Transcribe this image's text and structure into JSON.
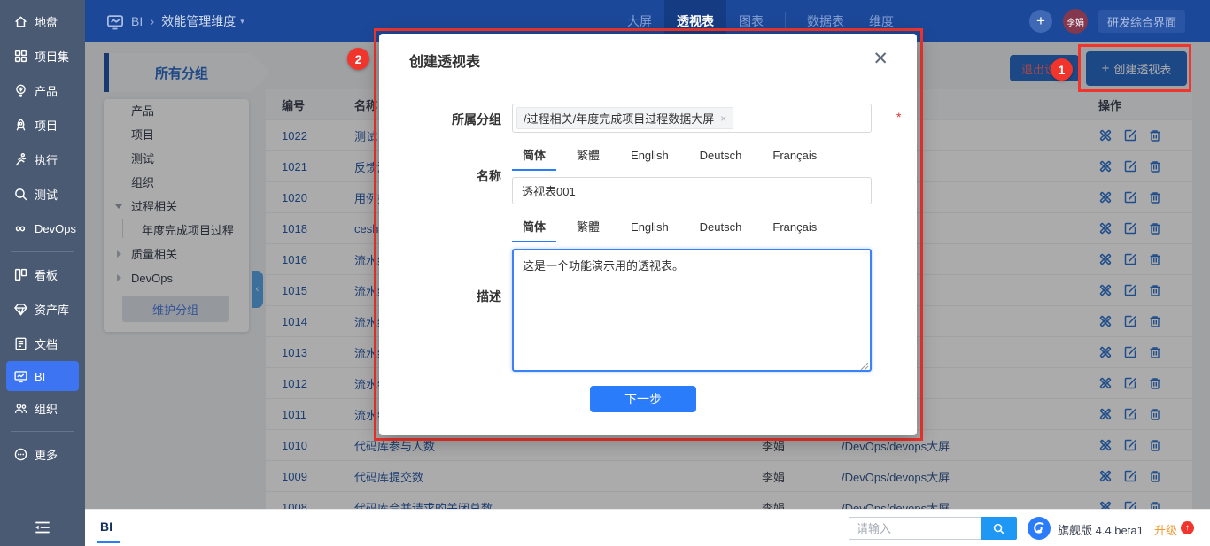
{
  "topbar": {
    "app": "BI",
    "breadcrumb_sep": "›",
    "section": "效能管理维度",
    "section_caret": "▾",
    "tabs": [
      {
        "key": "screen",
        "label": "大屏"
      },
      {
        "key": "pivot",
        "label": "透视表",
        "active": true
      },
      {
        "key": "chart",
        "label": "图表"
      },
      {
        "key": "dataset",
        "label": "数据表",
        "divider_before": true
      },
      {
        "key": "dimension",
        "label": "维度"
      }
    ],
    "add_plus": "+",
    "avatar": "李娟",
    "workspace_button": "研发综合界面"
  },
  "sidebar": {
    "items": [
      {
        "label": "地盘",
        "icon": "home-icon"
      },
      {
        "label": "项目集",
        "icon": "program-icon"
      },
      {
        "label": "产品",
        "icon": "product-icon"
      },
      {
        "label": "项目",
        "icon": "project-icon"
      },
      {
        "label": "执行",
        "icon": "execution-icon"
      },
      {
        "label": "测试",
        "icon": "test-icon"
      },
      {
        "label": "DevOps",
        "icon": "devops-icon"
      },
      {
        "divider": true
      },
      {
        "label": "看板",
        "icon": "kanban-icon"
      },
      {
        "label": "资产库",
        "icon": "asset-icon"
      },
      {
        "label": "文档",
        "icon": "doc-icon"
      },
      {
        "label": "BI",
        "icon": "bi-icon",
        "active": true
      },
      {
        "label": "组织",
        "icon": "org-icon"
      },
      {
        "divider": true
      },
      {
        "label": "更多",
        "icon": "more-icon"
      }
    ]
  },
  "toolbar": {
    "group_tab": "所有分组",
    "exit_button": "退出设置",
    "create_plus": "+",
    "create_button": "创建透视表"
  },
  "tree": {
    "items": [
      {
        "label": "产品"
      },
      {
        "label": "项目"
      },
      {
        "label": "测试"
      },
      {
        "label": "组织"
      },
      {
        "label": "过程相关",
        "caret": "down"
      },
      {
        "label": "年度完成项目过程",
        "child": true
      },
      {
        "label": "质量相关",
        "caret": "right"
      },
      {
        "label": "DevOps",
        "caret": "right"
      }
    ],
    "maintain_button": "维护分组",
    "collapse_arrow": "‹"
  },
  "table": {
    "headers": {
      "id": "编号",
      "name": "名称",
      "creator": "",
      "group": "",
      "actions": "操作"
    },
    "rows": [
      {
        "id": "1022",
        "name": "测试",
        "creator": "",
        "group": ""
      },
      {
        "id": "1021",
        "name": "反馈测",
        "creator": "",
        "group": ""
      },
      {
        "id": "1020",
        "name": "用例如",
        "creator": "",
        "group": ""
      },
      {
        "id": "1018",
        "name": "ceshi",
        "creator": "",
        "group": ""
      },
      {
        "id": "1016",
        "name": "流水线",
        "creator": "",
        "group": ""
      },
      {
        "id": "1015",
        "name": "流水线",
        "creator": "",
        "group": ""
      },
      {
        "id": "1014",
        "name": "流水线",
        "creator": "",
        "group": ""
      },
      {
        "id": "1013",
        "name": "流水线",
        "creator": "",
        "group": ""
      },
      {
        "id": "1012",
        "name": "流水线",
        "creator": "",
        "group": ""
      },
      {
        "id": "1011",
        "name": "流水线",
        "creator": "",
        "group": ""
      },
      {
        "id": "1010",
        "name": "代码库参与人数",
        "creator": "李娟",
        "group": "/DevOps/devops大屏"
      },
      {
        "id": "1009",
        "name": "代码库提交数",
        "creator": "李娟",
        "group": "/DevOps/devops大屏"
      },
      {
        "id": "1008",
        "name": "代码库合并请求的关闭总数",
        "creator": "李娟",
        "group": "/DevOps/devops大屏"
      }
    ]
  },
  "modal": {
    "title": "创建透视表",
    "close": "✕",
    "group_label": "所属分组",
    "group_tag": "/过程相关/年度完成项目过程数据大屏",
    "group_tag_remove": "×",
    "required_mark": "*",
    "name_label": "名称",
    "desc_label": "描述",
    "lang_tabs": [
      "简体",
      "繁體",
      "English",
      "Deutsch",
      "Français"
    ],
    "name_value": "透视表001",
    "desc_value": "这是一个功能演示用的透视表。",
    "next_button": "下一步"
  },
  "annotations": {
    "badge1": "1",
    "badge2": "2"
  },
  "bottombar": {
    "tab": "BI",
    "search_placeholder": "请输入",
    "version": "旗舰版 4.4.beta1",
    "upgrade": "升级",
    "upgrade_arrow": "↑"
  },
  "colors": {
    "topbar": "#1b4898",
    "sidebar": "#4a5a73",
    "primary": "#2b7cfa",
    "annotation_red": "#f1352c",
    "upgrade_orange": "#f19a37"
  }
}
